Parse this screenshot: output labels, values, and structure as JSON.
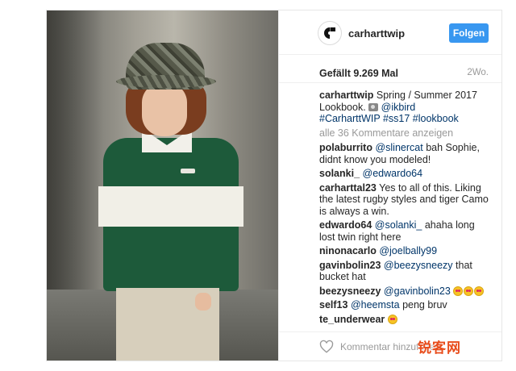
{
  "post": {
    "username": "carharttwip",
    "follow_label": "Folgen",
    "likes": "Gefällt 9.269 Mal",
    "time": "2Wo.",
    "caption": {
      "user": "carharttwip",
      "text": "Spring / Summer 2017 Lookbook.",
      "mention": "@ikbird",
      "hashtags": "#CarharttWIP #ss17 #lookbook"
    },
    "view_all": "alle 36 Kommentare anzeigen",
    "comments": [
      {
        "user": "polaburrito",
        "mention": "@slinercat",
        "text": "bah Sophie, didnt know you modeled!"
      },
      {
        "user": "solanki_",
        "mention": "@edwardo64",
        "text": ""
      },
      {
        "user": "carharttal23",
        "mention": "",
        "text": "Yes to all of this. Liking the latest rugby styles and tiger Camo is always a win."
      },
      {
        "user": "edwardo64",
        "mention": "@solanki_",
        "text": "ahaha long lost twin right here"
      },
      {
        "user": "ninonacarlo",
        "mention": "@joelbally99",
        "text": ""
      },
      {
        "user": "gavinbolin23",
        "mention": "@beezysneezy",
        "text": "that bucket hat"
      },
      {
        "user": "beezysneezy",
        "mention": "@gavinbolin23",
        "text": ""
      },
      {
        "user": "self13",
        "mention": "@heemsta",
        "text": "peng bruv"
      },
      {
        "user": "te_underwear",
        "mention": "",
        "text": ""
      }
    ],
    "comment_placeholder": "Kommentar hinzufügen...",
    "icons": {
      "avatar": "carhartt-logo-icon",
      "like": "heart-outline-icon",
      "caption_emoji": "camera-icon",
      "reaction_emoji": "heart-eyes-emoji-icon"
    }
  },
  "watermark": "锐客网",
  "colors": {
    "follow_button": "#3897f0",
    "link": "#003569",
    "muted": "#999999",
    "watermark": "#e84d1c"
  }
}
